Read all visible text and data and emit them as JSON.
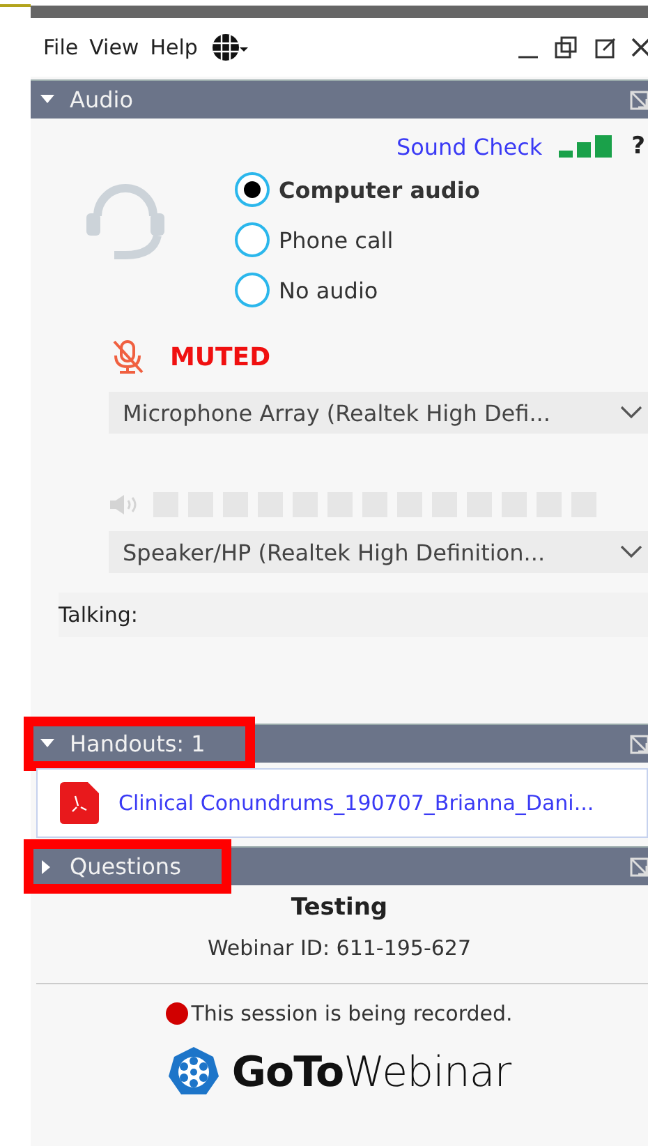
{
  "menu": [
    "File",
    "View",
    "Help"
  ],
  "audio": {
    "title": "Audio",
    "expanded": true,
    "sound_check": "Sound Check",
    "help": "?",
    "modes": [
      {
        "label": "Computer audio",
        "selected": true
      },
      {
        "label": "Phone call",
        "selected": false
      },
      {
        "label": "No audio",
        "selected": false
      }
    ],
    "mic_status": "MUTED",
    "microphone": "Microphone Array (Realtek High Defi...",
    "speaker": "Speaker/HP (Realtek High Definition...",
    "talking": "Talking:"
  },
  "handouts": {
    "title": "Handouts: 1",
    "expanded": true,
    "highlighted": true,
    "files": [
      "Clinical Conundrums_190707_Brianna_Dani..."
    ]
  },
  "questions": {
    "title": "Questions",
    "expanded": false,
    "highlighted": true
  },
  "footer": {
    "webinar_title": "Testing",
    "webinar_id": "Webinar ID: 611-195-627",
    "recording": "This session is being recorded.",
    "logo": "**GoTo**Webinar"
  }
}
